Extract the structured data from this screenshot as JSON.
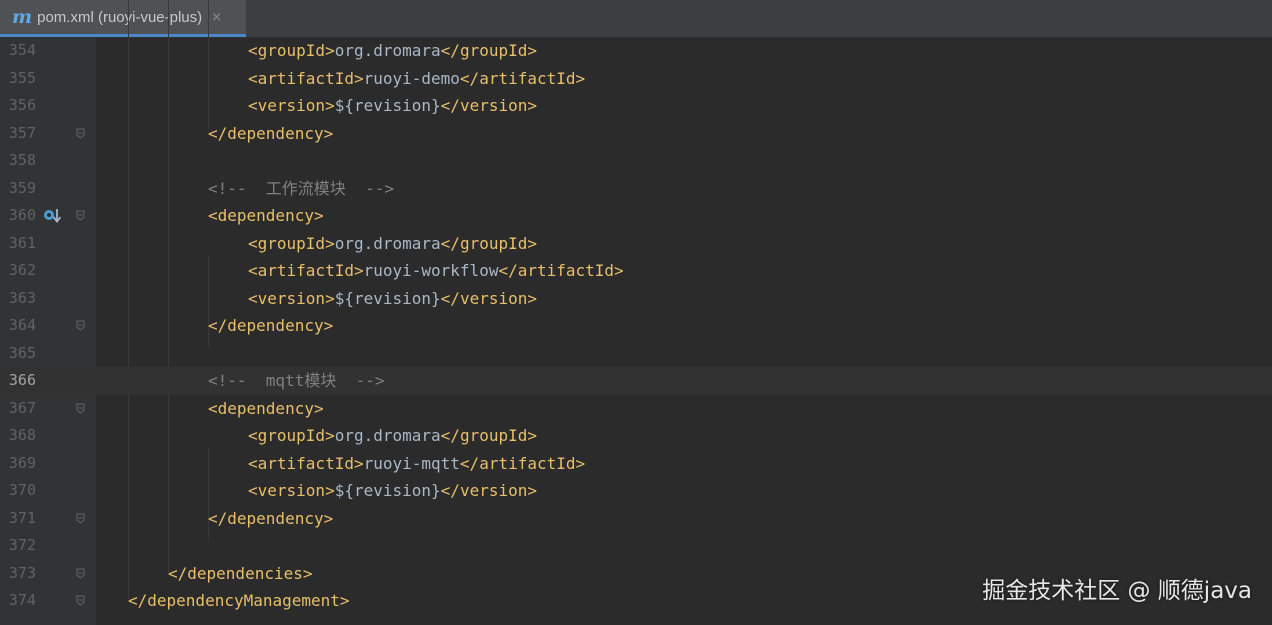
{
  "tab": {
    "icon": "maven-m-icon",
    "icon_glyph": "m",
    "label": "pom.xml (ruoyi-vue-plus)",
    "close_glyph": "×"
  },
  "lines": [
    {
      "num": "354",
      "tokens": [
        {
          "c": "tag",
          "t": "<groupId>"
        },
        {
          "c": "txt",
          "t": "org.dromara"
        },
        {
          "c": "tag",
          "t": "</groupId>"
        }
      ]
    },
    {
      "num": "355",
      "tokens": [
        {
          "c": "tag",
          "t": "<artifactId>"
        },
        {
          "c": "txt",
          "t": "ruoyi-demo"
        },
        {
          "c": "tag",
          "t": "</artifactId>"
        }
      ]
    },
    {
      "num": "356",
      "tokens": [
        {
          "c": "tag",
          "t": "<version>"
        },
        {
          "c": "txt",
          "t": "${revision}"
        },
        {
          "c": "tag",
          "t": "</version>"
        }
      ]
    },
    {
      "num": "357",
      "fold": true,
      "tokens": [
        {
          "c": "tag",
          "t": "</dependency>"
        }
      ]
    },
    {
      "num": "358",
      "tokens": []
    },
    {
      "num": "359",
      "tokens": [
        {
          "c": "cmt",
          "t": "<!--  工作流模块  -->"
        }
      ]
    },
    {
      "num": "360",
      "fold": true,
      "marker": true,
      "tokens": [
        {
          "c": "tag",
          "t": "<dependency>"
        }
      ]
    },
    {
      "num": "361",
      "tokens": [
        {
          "c": "tag",
          "t": "<groupId>"
        },
        {
          "c": "txt",
          "t": "org.dromara"
        },
        {
          "c": "tag",
          "t": "</groupId>"
        }
      ]
    },
    {
      "num": "362",
      "tokens": [
        {
          "c": "tag",
          "t": "<artifactId>"
        },
        {
          "c": "txt",
          "t": "ruoyi-workflow"
        },
        {
          "c": "tag",
          "t": "</artifactId>"
        }
      ]
    },
    {
      "num": "363",
      "tokens": [
        {
          "c": "tag",
          "t": "<version>"
        },
        {
          "c": "txt",
          "t": "${revision}"
        },
        {
          "c": "tag",
          "t": "</version>"
        }
      ]
    },
    {
      "num": "364",
      "fold": true,
      "tokens": [
        {
          "c": "tag",
          "t": "</dependency>"
        }
      ]
    },
    {
      "num": "365",
      "tokens": []
    },
    {
      "num": "366",
      "current": true,
      "tokens": [
        {
          "c": "cmt",
          "t": "<!--  mqtt模块  -->"
        }
      ]
    },
    {
      "num": "367",
      "fold": true,
      "tokens": [
        {
          "c": "tag",
          "t": "<dependency>"
        }
      ]
    },
    {
      "num": "368",
      "tokens": [
        {
          "c": "tag",
          "t": "<groupId>"
        },
        {
          "c": "txt",
          "t": "org.dromara"
        },
        {
          "c": "tag",
          "t": "</groupId>"
        }
      ]
    },
    {
      "num": "369",
      "tokens": [
        {
          "c": "tag",
          "t": "<artifactId>"
        },
        {
          "c": "txt",
          "t": "ruoyi-mqtt"
        },
        {
          "c": "tag",
          "t": "</artifactId>"
        }
      ]
    },
    {
      "num": "370",
      "tokens": [
        {
          "c": "tag",
          "t": "<version>"
        },
        {
          "c": "txt",
          "t": "${revision}"
        },
        {
          "c": "tag",
          "t": "</version>"
        }
      ]
    },
    {
      "num": "371",
      "fold": true,
      "tokens": [
        {
          "c": "tag",
          "t": "</dependency>"
        }
      ]
    },
    {
      "num": "372",
      "tokens": []
    },
    {
      "num": "373",
      "fold": true,
      "tokens": [
        {
          "c": "tag",
          "t": "</dependencies>"
        }
      ]
    },
    {
      "num": "374",
      "fold": true,
      "tokens": [
        {
          "c": "tag",
          "t": "</dependencyManagement>"
        }
      ]
    }
  ],
  "watermark": "掘金技术社区 @ 顺德java",
  "colors": {
    "background": "#2b2b2b",
    "gutter": "#313335",
    "xml_tag": "#e8bf6a",
    "text": "#a9b7c6",
    "comment": "#808080",
    "line_number": "#606366",
    "tab_underline": "#4a88c7"
  }
}
